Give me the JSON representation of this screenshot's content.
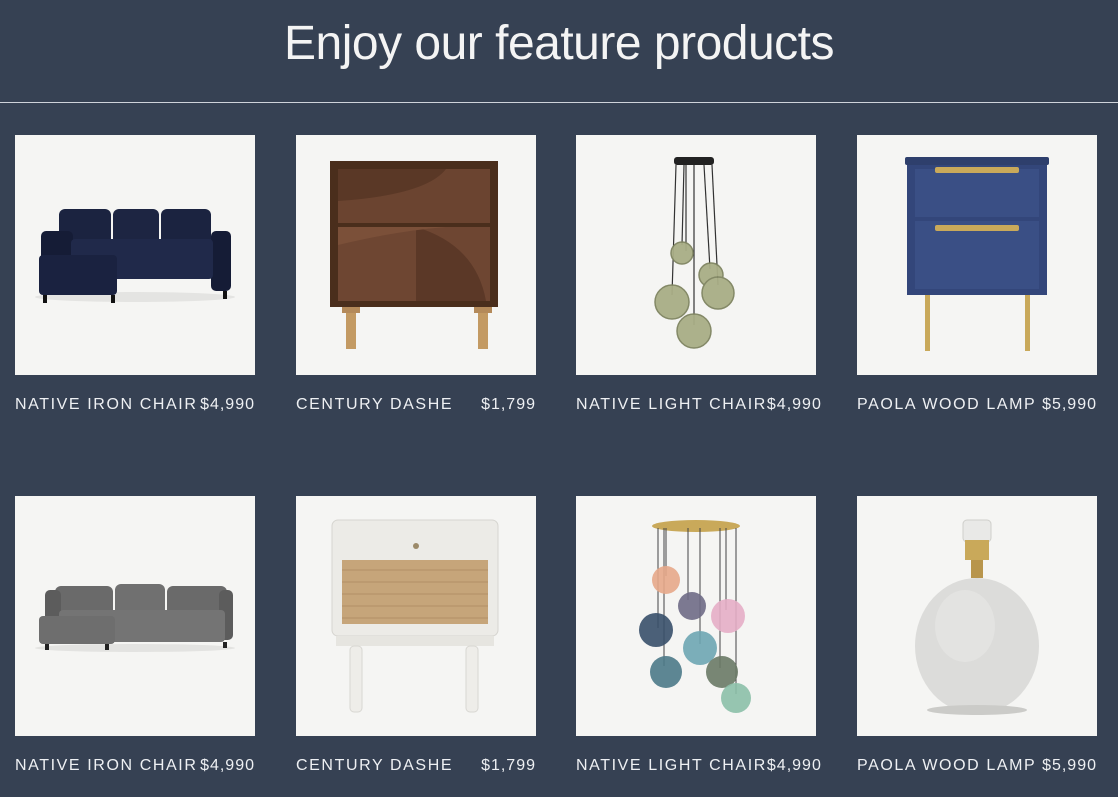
{
  "section": {
    "title": "Enjoy our feature products"
  },
  "products": [
    {
      "name": "NATIVE IRON CHAIR",
      "price": "$4,990",
      "icon": "navy-sofa-image"
    },
    {
      "name": "CENTURY DASHE",
      "price": "$1,799",
      "icon": "walnut-nightstand-image"
    },
    {
      "name": "NATIVE LIGHT CHAIR",
      "price": "$4,990",
      "icon": "glass-pendant-light-image"
    },
    {
      "name": "PAOLA WOOD LAMP",
      "price": "$5,990",
      "icon": "blue-nightstand-image"
    },
    {
      "name": "NATIVE IRON CHAIR",
      "price": "$4,990",
      "icon": "grey-sofa-image"
    },
    {
      "name": "CENTURY DASHE",
      "price": "$1,799",
      "icon": "rattan-side-table-image"
    },
    {
      "name": "NATIVE LIGHT CHAIR",
      "price": "$4,990",
      "icon": "multicolor-pendant-light-image"
    },
    {
      "name": "PAOLA WOOD LAMP",
      "price": "$5,990",
      "icon": "stone-lamp-base-image"
    }
  ],
  "colors": {
    "background": "#364153",
    "card_image_bg": "#f5f5f3",
    "text": "#eef0f3"
  }
}
